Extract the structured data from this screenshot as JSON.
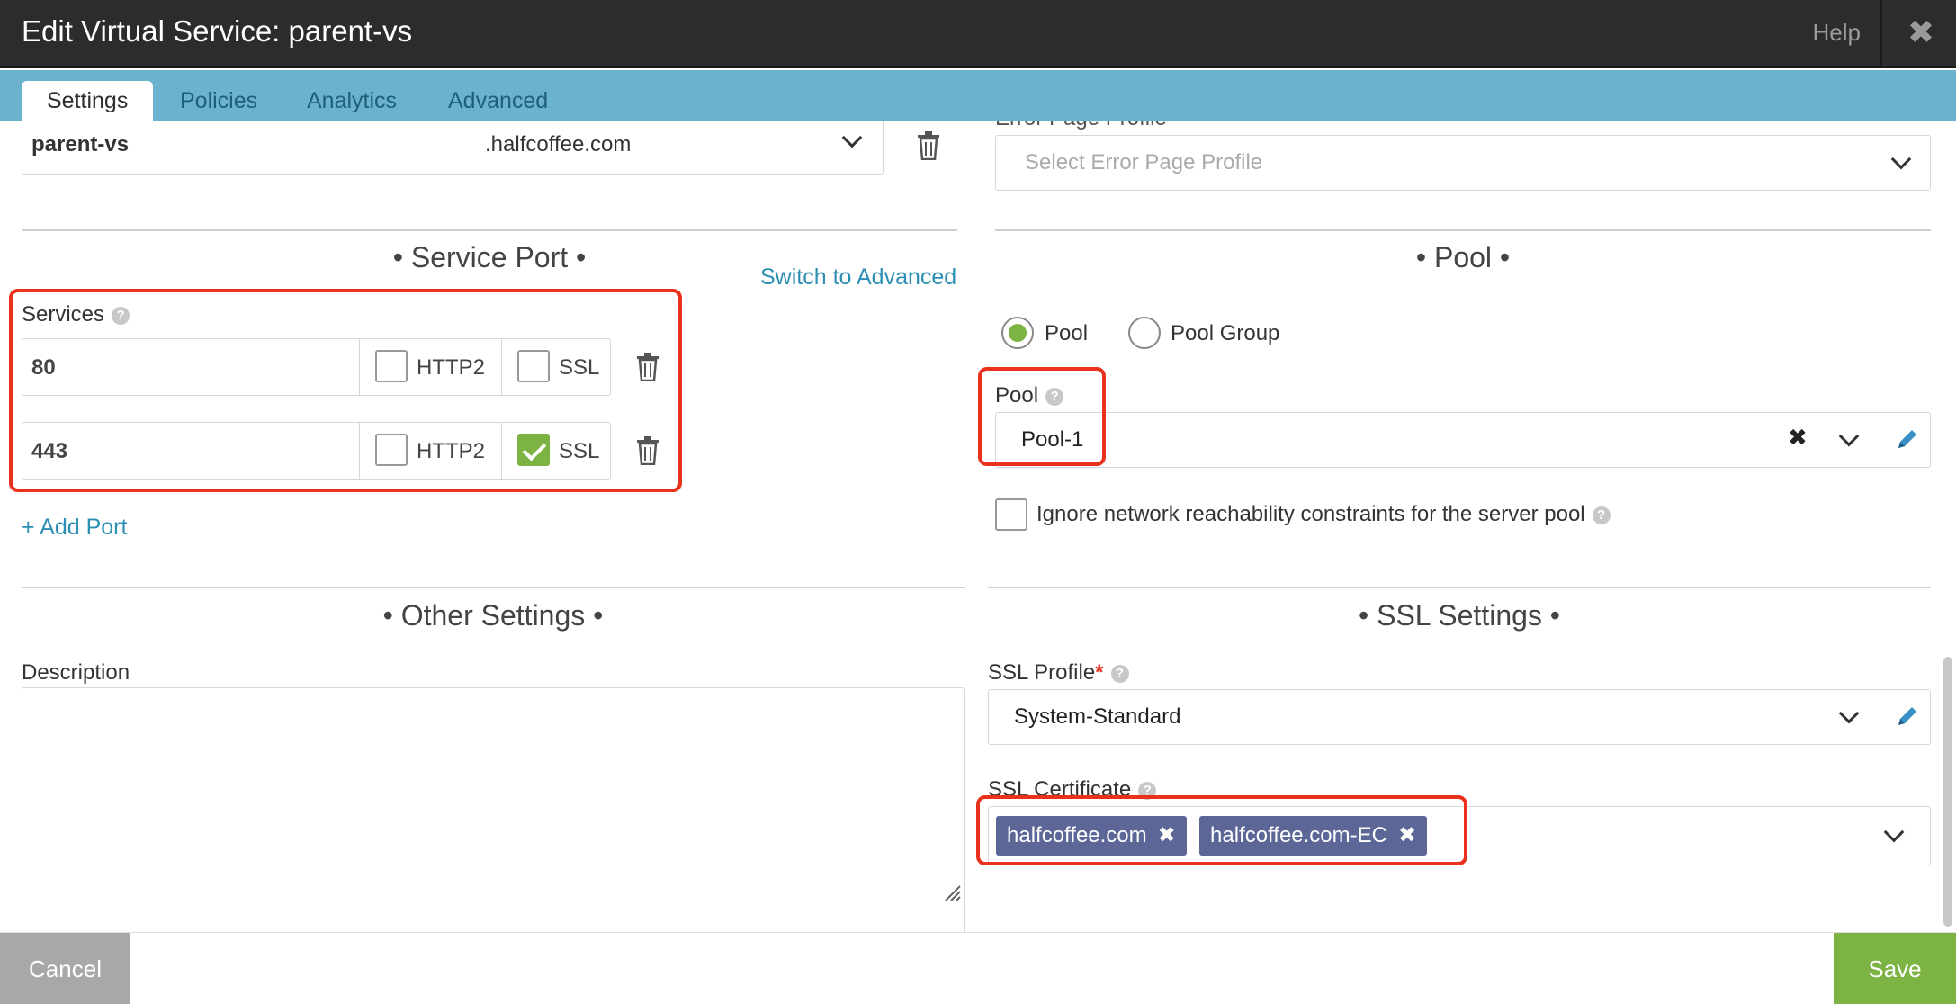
{
  "window": {
    "title": "Edit Virtual Service: parent-vs",
    "help_label": "Help",
    "close_glyph": "✖"
  },
  "tabs": [
    {
      "label": "Settings",
      "active": true
    },
    {
      "label": "Policies",
      "active": false
    },
    {
      "label": "Analytics",
      "active": false
    },
    {
      "label": "Advanced",
      "active": false
    }
  ],
  "fqdn": {
    "name": "parent-vs",
    "domain": ".halfcoffee.com"
  },
  "error_page": {
    "label": "Error Page Profile",
    "placeholder": "Select Error Page Profile"
  },
  "service_port": {
    "section_title": "• Service Port •",
    "switch_link": "Switch to Advanced",
    "services_label": "Services",
    "rows": [
      {
        "port": "80",
        "http2_label": "HTTP2",
        "http2": false,
        "ssl_label": "SSL",
        "ssl": false
      },
      {
        "port": "443",
        "http2_label": "HTTP2",
        "http2": false,
        "ssl_label": "SSL",
        "ssl": true
      }
    ],
    "add_port": "+ Add Port"
  },
  "pool_section": {
    "section_title": "• Pool •",
    "radio_pool": "Pool",
    "radio_pool_group": "Pool Group",
    "selected": "Pool",
    "pool_label": "Pool",
    "pool_value": "Pool-1",
    "ignore_label": "Ignore network reachability constraints for the server pool"
  },
  "other_settings": {
    "section_title": "• Other Settings •",
    "description_label": "Description",
    "description_value": ""
  },
  "ssl_settings": {
    "section_title": "• SSL Settings •",
    "profile_label": "SSL Profile",
    "required_mark": "*",
    "profile_value": "System-Standard",
    "certificate_label": "SSL Certificate",
    "certificates": [
      "halfcoffee.com",
      "halfcoffee.com-EC"
    ]
  },
  "footer": {
    "cancel": "Cancel",
    "save": "Save"
  },
  "colors": {
    "accent_green": "#7cb342",
    "tab_bar": "#6ab2cd",
    "highlight_red": "#e8321d",
    "chip": "#5c6797"
  },
  "icons": [
    "trash-icon",
    "chevron-down-icon",
    "pencil-icon",
    "help-icon",
    "clear-icon",
    "close-icon"
  ]
}
